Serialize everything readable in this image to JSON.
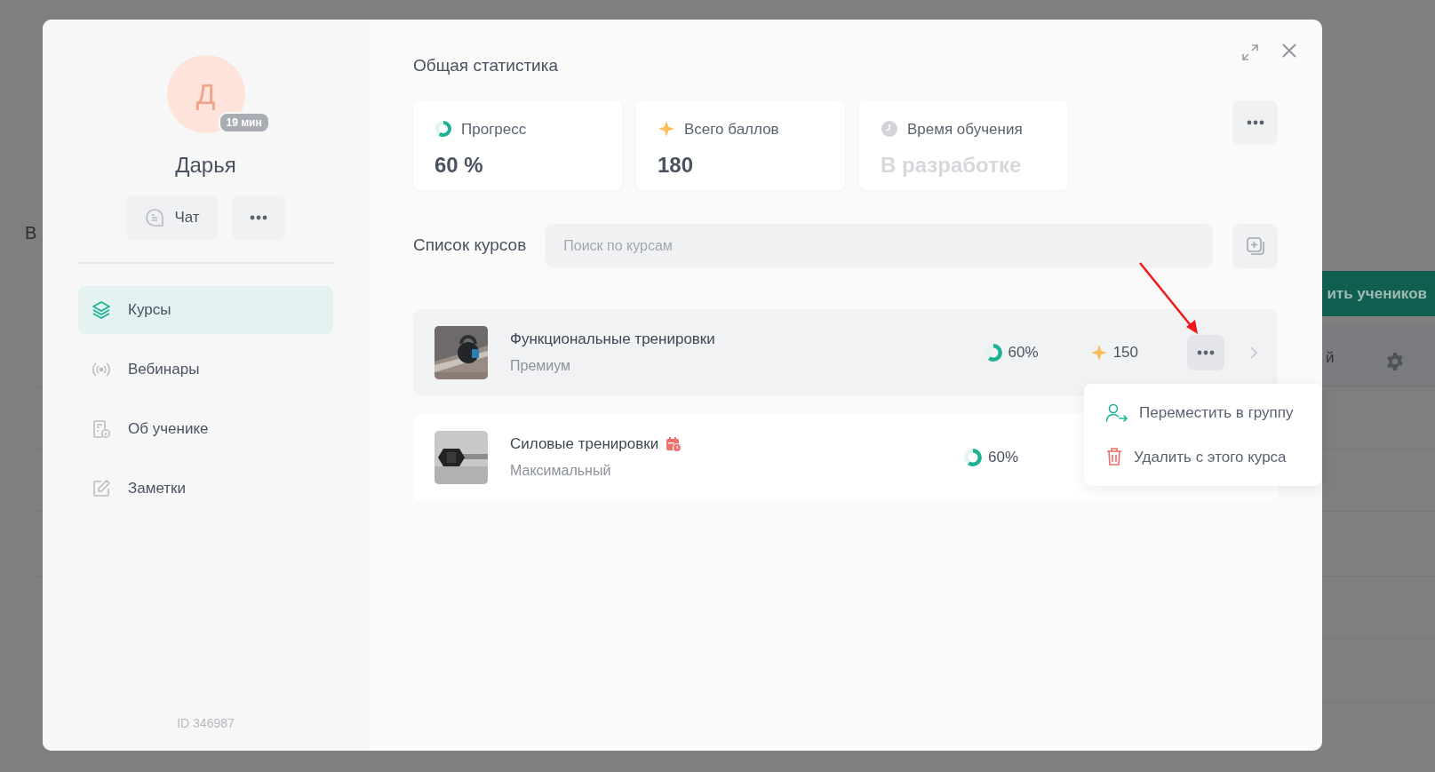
{
  "background": {
    "heading_fragment": "В",
    "button": "ить учеников",
    "column_fragment": "й"
  },
  "profile": {
    "initial": "Д",
    "badge": "19 мин",
    "name": "Дарья",
    "chat_button": "Чат"
  },
  "sidebar": {
    "items": [
      {
        "label": "Курсы",
        "selected": true
      },
      {
        "label": "Вебинары",
        "selected": false
      },
      {
        "label": "Об ученике",
        "selected": false
      },
      {
        "label": "Заметки",
        "selected": false
      }
    ],
    "id_label": "ID 346987"
  },
  "stats": {
    "title": "Общая статистика",
    "cards": [
      {
        "kind": "progress",
        "label": "Прогресс",
        "value": "60 %",
        "level": 0.6,
        "disabled": false
      },
      {
        "kind": "points",
        "label": "Всего баллов",
        "value": "180",
        "disabled": false
      },
      {
        "kind": "time",
        "label": "Время обучения",
        "value": "В разработке",
        "disabled": true
      }
    ]
  },
  "courses": {
    "title": "Список курсов",
    "search": {
      "placeholder": "Поиск по курсам"
    },
    "rows": [
      {
        "title": "Функциональные тренировки",
        "plan": "Премиум",
        "scheduled": false,
        "progress": "60%",
        "level": 0.6,
        "points": "150",
        "highlighted": true
      },
      {
        "title": "Силовые тренировки",
        "plan": "Максимальный",
        "scheduled": true,
        "progress": "60%",
        "level": 0.6,
        "highlighted": false
      }
    ]
  },
  "menu": {
    "items": [
      {
        "kind": "move",
        "label": "Переместить в группу"
      },
      {
        "kind": "delete",
        "label": "Удалить с этого курса"
      }
    ]
  }
}
